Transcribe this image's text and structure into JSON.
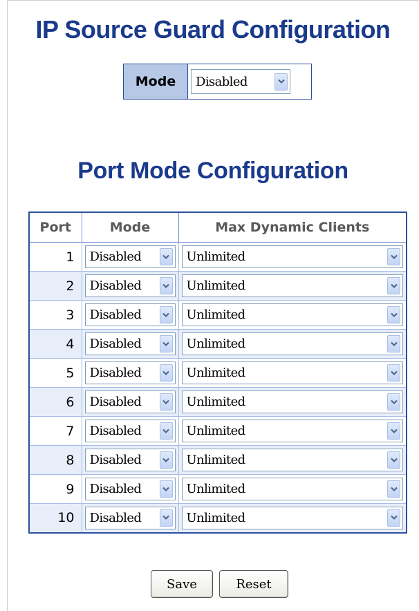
{
  "page": {
    "title": "IP Source Guard Configuration",
    "port_section_title": "Port Mode Configuration"
  },
  "global": {
    "mode_label": "Mode",
    "mode_value": "Disabled"
  },
  "table": {
    "headers": [
      "Port",
      "Mode",
      "Max Dynamic Clients"
    ],
    "rows": [
      {
        "port": "1",
        "mode": "Disabled",
        "max_clients": "Unlimited"
      },
      {
        "port": "2",
        "mode": "Disabled",
        "max_clients": "Unlimited"
      },
      {
        "port": "3",
        "mode": "Disabled",
        "max_clients": "Unlimited"
      },
      {
        "port": "4",
        "mode": "Disabled",
        "max_clients": "Unlimited"
      },
      {
        "port": "5",
        "mode": "Disabled",
        "max_clients": "Unlimited"
      },
      {
        "port": "6",
        "mode": "Disabled",
        "max_clients": "Unlimited"
      },
      {
        "port": "7",
        "mode": "Disabled",
        "max_clients": "Unlimited"
      },
      {
        "port": "8",
        "mode": "Disabled",
        "max_clients": "Unlimited"
      },
      {
        "port": "9",
        "mode": "Disabled",
        "max_clients": "Unlimited"
      },
      {
        "port": "10",
        "mode": "Disabled",
        "max_clients": "Unlimited"
      }
    ]
  },
  "buttons": {
    "save_label": "Save",
    "reset_label": "Reset"
  },
  "icons": {
    "dropdown": "chevron-down-icon"
  },
  "colors": {
    "title": "#1a3a8c",
    "table_border": "#2b4f9b",
    "header_label_bg": "#b7c7e6",
    "row_alt_bg": "#e8eef9"
  }
}
